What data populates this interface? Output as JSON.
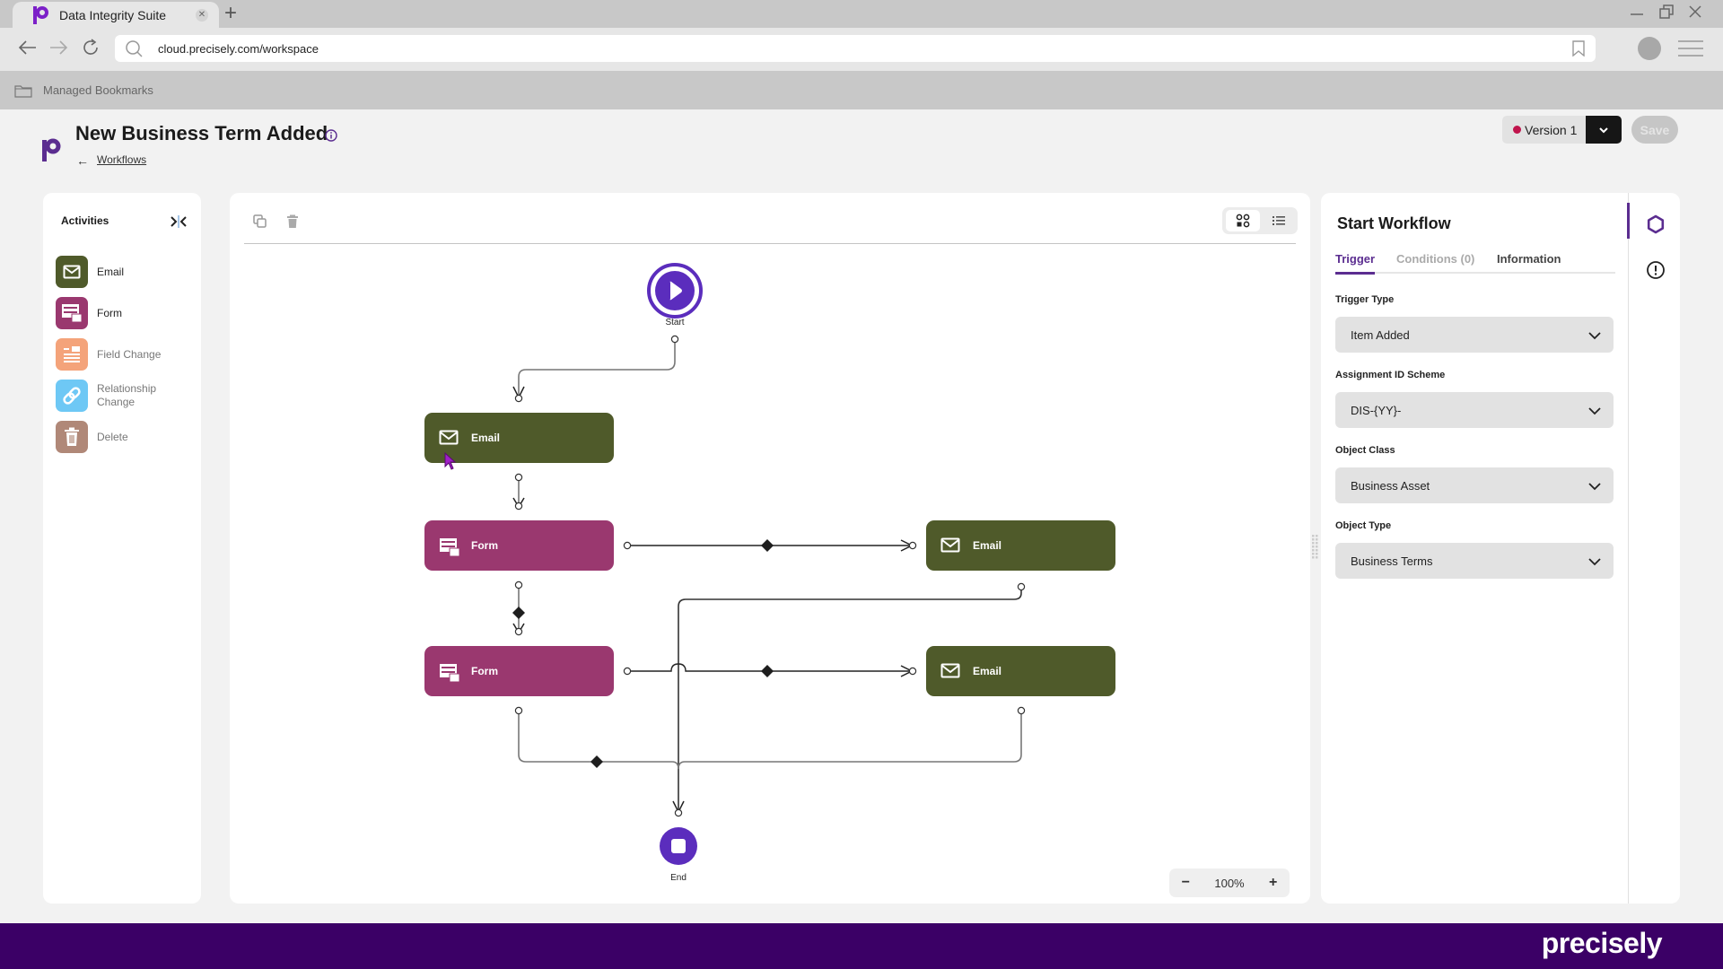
{
  "browser": {
    "tab_title": "Data Integrity Suite",
    "url": "cloud.precisely.com/workspace",
    "bookmarks_folder": "Managed Bookmarks"
  },
  "header": {
    "title": "New Business Term Added",
    "back_arrow": "←",
    "back_link": "Workflows",
    "version_label": "Version 1",
    "version_status_color": "#c0144c",
    "save_label": "Save"
  },
  "activities": {
    "title": "Activities",
    "items": [
      {
        "label": "Email",
        "icon": "envelope-icon",
        "color": "#4f5a2a",
        "enabled": true
      },
      {
        "label": "Form",
        "icon": "form-icon",
        "color": "#9a386f",
        "enabled": true
      },
      {
        "label": "Field Change",
        "icon": "field-change-icon",
        "color": "#f4a37a",
        "enabled": false
      },
      {
        "label": "Relationship Change",
        "icon": "link-icon",
        "color": "#6ec8f5",
        "enabled": false
      },
      {
        "label": "Delete",
        "icon": "trash-icon",
        "color": "#b08878",
        "enabled": false
      }
    ]
  },
  "canvas": {
    "zoom_level": "100%",
    "zoom_out": "−",
    "zoom_in": "+",
    "start_label": "Start",
    "end_label": "End",
    "nodes": [
      {
        "id": "email-1",
        "type": "email",
        "label": "Email"
      },
      {
        "id": "form-1",
        "type": "form",
        "label": "Form"
      },
      {
        "id": "email-2",
        "type": "email",
        "label": "Email"
      },
      {
        "id": "form-2",
        "type": "form",
        "label": "Form"
      },
      {
        "id": "email-3",
        "type": "email",
        "label": "Email"
      }
    ]
  },
  "properties": {
    "title": "Start Workflow",
    "tabs": [
      {
        "label": "Trigger",
        "active": true
      },
      {
        "label": "Conditions (0)",
        "active": false
      },
      {
        "label": "Information",
        "active": false
      }
    ],
    "fields": [
      {
        "label": "Trigger Type",
        "value": "Item Added"
      },
      {
        "label": "Assignment ID Scheme",
        "value": "DIS-{YY}-"
      },
      {
        "label": "Object Class",
        "value": "Business Asset"
      },
      {
        "label": "Object Type",
        "value": "Business Terms"
      }
    ]
  },
  "footer": {
    "brand": "precisely"
  },
  "colors": {
    "accent": "#5b2d90",
    "email_node": "#4f5a2a",
    "form_node": "#9a386f",
    "footer": "#3b0066"
  }
}
